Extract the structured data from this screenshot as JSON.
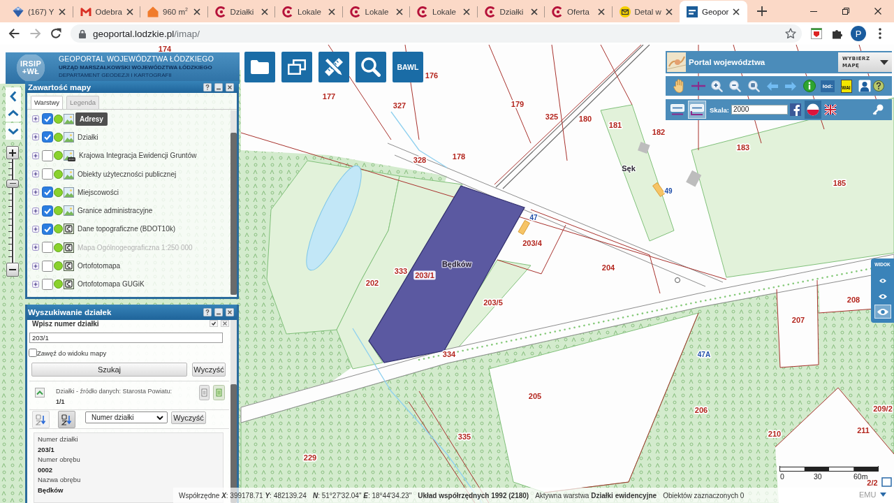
{
  "browser": {
    "tabs": [
      {
        "title": "(167) Y",
        "kind": "gem",
        "selected": false
      },
      {
        "title": "Odebra",
        "kind": "gmail",
        "selected": false
      },
      {
        "title": "960 m$^{2}$",
        "kind": "house",
        "selected": false
      },
      {
        "title": "Działki",
        "kind": "swirl",
        "selected": false
      },
      {
        "title": "Lokale",
        "kind": "swirl",
        "selected": false
      },
      {
        "title": "Lokale",
        "kind": "swirl",
        "selected": false
      },
      {
        "title": "Lokale",
        "kind": "swirl",
        "selected": false
      },
      {
        "title": "Działki",
        "kind": "swirl",
        "selected": false
      },
      {
        "title": "Oferta",
        "kind": "swirl",
        "selected": false
      },
      {
        "title": "Detal w",
        "kind": "envelope",
        "selected": false
      },
      {
        "title": "Geopor",
        "kind": "city",
        "selected": true
      }
    ],
    "nav": [
      {
        "kind": "back",
        "disabled": false
      },
      {
        "kind": "forward",
        "disabled": true
      },
      {
        "kind": "reload",
        "disabled": false
      }
    ],
    "url": {
      "host": "geoportal.lodzkie.pl",
      "path": "/imap/"
    },
    "profile": {
      "initial": "P"
    }
  },
  "header": {
    "logo": [
      "IRSIP",
      "+WŁ"
    ],
    "title": "GEOPORTAL WOJEWÓDZTWA ŁÓDZKIEGO",
    "subtitle": "URZĄD MARSZAŁKOWSKI WOJEWÓDZTWA ŁÓDZKIEGO",
    "department": "DEPARTAMENT GEODEZJI I KARTOGRAFII"
  },
  "toolbar": [
    {
      "kind": "folder"
    },
    {
      "kind": "windows"
    },
    {
      "kind": "tools"
    },
    {
      "kind": "search"
    },
    {
      "kind": "text",
      "label": "BAWL"
    }
  ],
  "map_controls": {
    "zoom": {
      "level": 0.79
    }
  },
  "layers_panel": {
    "title": "Zawartość mapy",
    "tabs": [
      {
        "label": "Warstwy",
        "selected": true
      },
      {
        "label": "Legenda",
        "selected": false
      }
    ],
    "layers": [
      {
        "label": "Adresy",
        "kind": "image",
        "checked": true,
        "selected": true,
        "disabled": false
      },
      {
        "label": "Działki",
        "kind": "image",
        "checked": true,
        "selected": false,
        "disabled": false
      },
      {
        "label": "Krajowa Integracja Ewidencji Gruntów",
        "kind": "wms",
        "checked": false,
        "selected": false,
        "disabled": false
      },
      {
        "label": "Obiekty użyteczności publicznej",
        "kind": "image",
        "checked": false,
        "selected": false,
        "disabled": false
      },
      {
        "label": "Miejscowości",
        "kind": "image",
        "checked": true,
        "selected": false,
        "disabled": false
      },
      {
        "label": "Granice administracyjne",
        "kind": "image",
        "checked": true,
        "selected": false,
        "disabled": false
      },
      {
        "label": "Dane topograficzne (BDOT10k)",
        "kind": "service",
        "checked": true,
        "selected": false,
        "disabled": false
      },
      {
        "label": "Mapa Ogólnogeograficzna 1:250 000",
        "kind": "service",
        "checked": false,
        "selected": false,
        "disabled": true
      },
      {
        "label": "Ortofotomapa",
        "kind": "service",
        "checked": false,
        "selected": false,
        "disabled": false
      },
      {
        "label": "Ortofotomapa GUGiK",
        "kind": "service",
        "checked": false,
        "selected": false,
        "disabled": false
      }
    ]
  },
  "search_panel": {
    "title": "Wyszukiwanie działek",
    "prompt": "Wpisz numer działki",
    "input": {
      "value": "203/1"
    },
    "limit_to_view": {
      "label": "Zawęź do widoku mapy",
      "checked": false
    },
    "search_button": "Szukaj",
    "clear_button": "Wyczyść",
    "source": {
      "text": "Działki - źródło danych: Starosta Powiatu:",
      "count": "1/1"
    },
    "sort": {
      "buttons": [
        {
          "selected": false
        },
        {
          "selected": true
        }
      ],
      "field": "Numer działki",
      "clear_button": "Wyczyść"
    },
    "result": [
      {
        "label": "Numer działki",
        "value": "203/1"
      },
      {
        "label": "Numer obrębu",
        "value": "0002"
      },
      {
        "label": "Nazwa obrębu",
        "value": "Będków"
      }
    ]
  },
  "portal_panel": {
    "title": "Portal województwa",
    "map_picker": "WYBIERZ MAPĘ",
    "tools": [
      {
        "kind": "hand"
      },
      {
        "kind": "pan"
      },
      {
        "kind": "zoom_in"
      },
      {
        "kind": "zoom_out"
      },
      {
        "kind": "zoom_extent"
      },
      {
        "kind": "back"
      },
      {
        "kind": "forward"
      },
      {
        "kind": "info"
      },
      {
        "kind": "city",
        "text": "łód:"
      },
      {
        "kind": "badge",
        "text": "WAI"
      },
      {
        "kind": "user"
      },
      {
        "kind": "help"
      }
    ],
    "scale_modes": [
      {
        "selected": false
      },
      {
        "selected": true
      }
    ],
    "scale": {
      "label": "Skala:",
      "value": "2000"
    },
    "languages": [
      {
        "kind": "pl",
        "selected": true
      },
      {
        "kind": "en",
        "selected": false
      }
    ]
  },
  "map": {
    "labels": [
      {
        "kind": "parcel",
        "text": "174"
      },
      {
        "kind": "parcel",
        "text": "176"
      },
      {
        "kind": "parcel",
        "text": "177"
      },
      {
        "kind": "parcel",
        "text": "327"
      },
      {
        "kind": "parcel",
        "text": "179"
      },
      {
        "kind": "parcel",
        "text": "325"
      },
      {
        "kind": "parcel",
        "text": "180"
      },
      {
        "kind": "parcel",
        "text": "181"
      },
      {
        "kind": "parcel",
        "text": "182"
      },
      {
        "kind": "parcel",
        "text": "183"
      },
      {
        "kind": "parcel",
        "text": "178"
      },
      {
        "kind": "parcel",
        "text": "328"
      },
      {
        "kind": "place",
        "text": "Sęk"
      },
      {
        "kind": "parcel",
        "text": "185"
      },
      {
        "kind": "address",
        "text": "49"
      },
      {
        "kind": "address",
        "text": "47"
      },
      {
        "kind": "parcel",
        "text": "203/4"
      },
      {
        "kind": "place",
        "text": "Będków"
      },
      {
        "kind": "parcel",
        "text": "204"
      },
      {
        "kind": "parcel",
        "text": "333"
      },
      {
        "kind": "parcel",
        "text": "203/1"
      },
      {
        "kind": "parcel",
        "text": "202"
      },
      {
        "kind": "parcel",
        "text": "208"
      },
      {
        "kind": "parcel",
        "text": "203/5"
      },
      {
        "kind": "parcel",
        "text": "207"
      },
      {
        "kind": "parcel",
        "text": "334"
      },
      {
        "kind": "address",
        "text": "47A"
      },
      {
        "kind": "parcel",
        "text": "205"
      },
      {
        "kind": "parcel",
        "text": "209/2"
      },
      {
        "kind": "parcel",
        "text": "206"
      },
      {
        "kind": "parcel",
        "text": "211"
      },
      {
        "kind": "parcel",
        "text": "210"
      },
      {
        "kind": "parcel",
        "text": "335"
      },
      {
        "kind": "parcel",
        "text": "229"
      },
      {
        "kind": "parcel",
        "text": "2/2"
      }
    ]
  },
  "view_panel": {
    "title": "WIDOK",
    "options": [
      {
        "selected": false
      },
      {
        "selected": false
      },
      {
        "selected": true
      }
    ]
  },
  "scale_bar": {
    "labels": [
      "0",
      "30",
      "60m"
    ]
  },
  "corner_menu": {
    "label": "EMU"
  },
  "status_bar": {
    "planar": "Współrzędne **X**: 399178.71 **Y**: 482139.24",
    "geographic": "**N**: 51°27'32.04\" **E**: 18°44'34.23\"",
    "crs": "Układ współrzędnych 1992 (2180)",
    "active_layer": "Aktywna warstwa **Działki ewidencyjne**",
    "selected_count": "Obiektów zaznaczonych 0"
  }
}
